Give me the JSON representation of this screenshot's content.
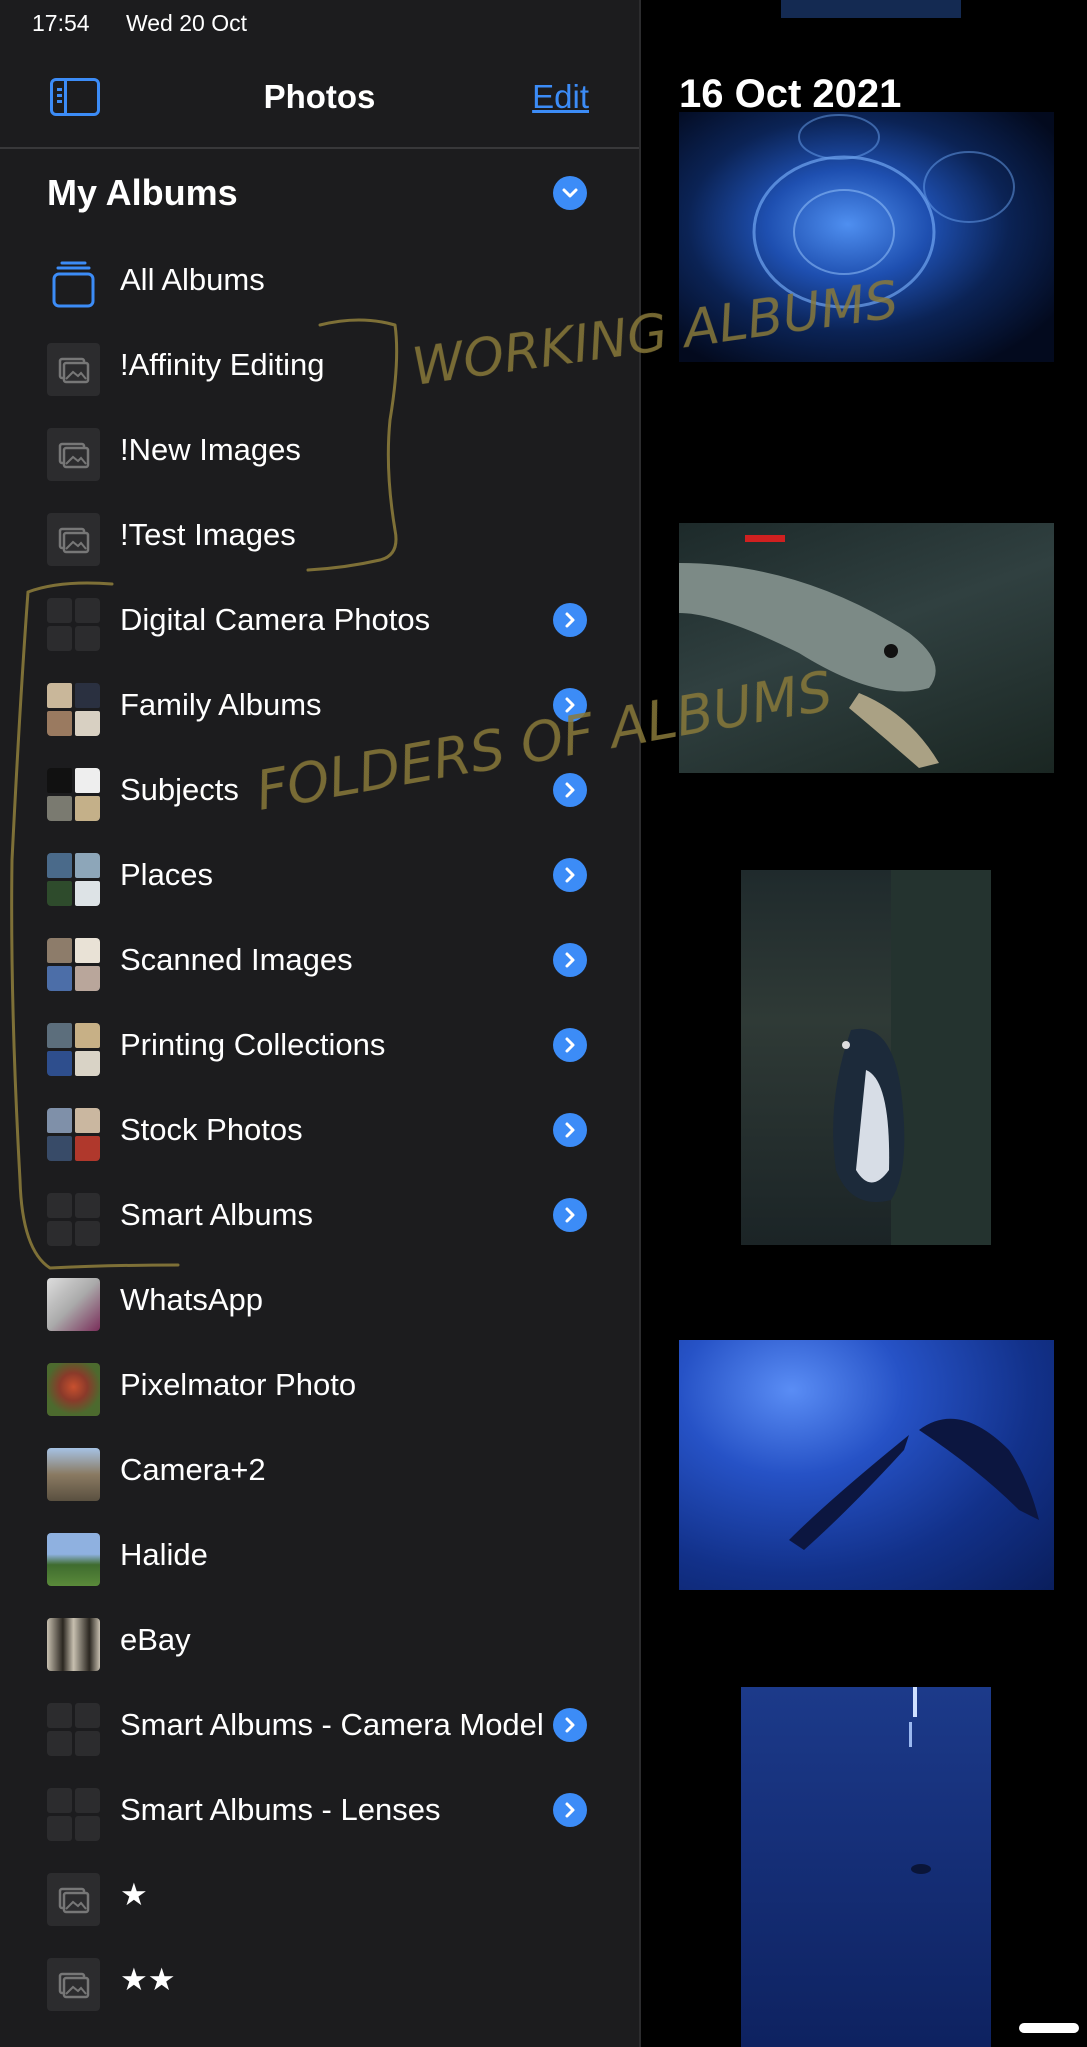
{
  "status_bar": {
    "time": "17:54",
    "date": "Wed 20 Oct"
  },
  "nav": {
    "title": "Photos",
    "edit_label": "Edit"
  },
  "section": {
    "title": "My Albums"
  },
  "albums": [
    {
      "label": "All Albums",
      "thumb": "stack-icon",
      "chevron": false
    },
    {
      "label": "!Affinity Editing",
      "thumb": "photo-album-icon",
      "chevron": false
    },
    {
      "label": "!New Images",
      "thumb": "photo-album-icon",
      "chevron": false
    },
    {
      "label": "!Test Images",
      "thumb": "photo-album-icon",
      "chevron": false
    },
    {
      "label": "Digital Camera Photos",
      "thumb": "folder-grid",
      "chevron": true
    },
    {
      "label": "Family Albums",
      "thumb": "folder-grid-photos",
      "chevron": true
    },
    {
      "label": "Subjects",
      "thumb": "folder-grid-photos",
      "chevron": true
    },
    {
      "label": "Places",
      "thumb": "folder-grid-photos",
      "chevron": true
    },
    {
      "label": "Scanned Images",
      "thumb": "folder-grid-photos",
      "chevron": true
    },
    {
      "label": "Printing Collections",
      "thumb": "folder-grid-photos",
      "chevron": true
    },
    {
      "label": "Stock Photos",
      "thumb": "folder-grid-photos",
      "chevron": true
    },
    {
      "label": "Smart Albums",
      "thumb": "folder-grid",
      "chevron": true
    },
    {
      "label": "WhatsApp",
      "thumb": "photo",
      "chevron": false
    },
    {
      "label": "Pixelmator Photo",
      "thumb": "photo",
      "chevron": false
    },
    {
      "label": "Camera+2",
      "thumb": "photo",
      "chevron": false
    },
    {
      "label": "Halide",
      "thumb": "photo",
      "chevron": false
    },
    {
      "label": "eBay",
      "thumb": "photo",
      "chevron": false
    },
    {
      "label": "Smart Albums - Camera Model",
      "thumb": "folder-grid",
      "chevron": true
    },
    {
      "label": "Smart Albums - Lenses",
      "thumb": "folder-grid",
      "chevron": true
    },
    {
      "label": "★",
      "thumb": "photo-album-icon",
      "chevron": false
    },
    {
      "label": "★★",
      "thumb": "photo-album-icon",
      "chevron": false
    }
  ],
  "photo_pane": {
    "date_heading": "16 Oct 2021"
  },
  "annotations": {
    "working_albums": "WORKING ALBUMS",
    "folders_of_albums": "FOLDERS OF ALBUMS"
  },
  "colors": {
    "accent": "#3c8cf7",
    "sidebar_bg": "#1c1c1e",
    "handwriting": "#8a7a3a"
  }
}
